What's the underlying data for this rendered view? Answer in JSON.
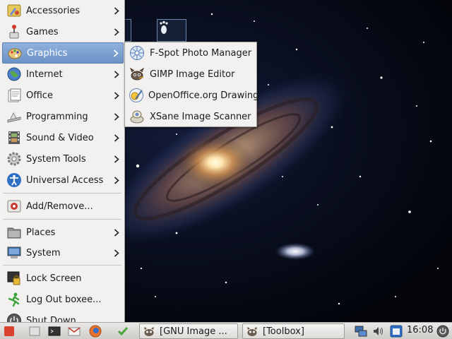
{
  "menu": {
    "items": [
      {
        "label": "Accessories"
      },
      {
        "label": "Games"
      },
      {
        "label": "Graphics"
      },
      {
        "label": "Internet"
      },
      {
        "label": "Office"
      },
      {
        "label": "Programming"
      },
      {
        "label": "Sound & Video"
      },
      {
        "label": "System Tools"
      },
      {
        "label": "Universal Access"
      }
    ],
    "add_remove": "Add/Remove...",
    "places": "Places",
    "system": "System",
    "lock_screen": "Lock Screen",
    "log_out": "Log Out boxee...",
    "shut_down": "Shut Down..."
  },
  "graphics_submenu": {
    "items": [
      {
        "label": "F-Spot Photo Manager"
      },
      {
        "label": "GIMP Image Editor"
      },
      {
        "label": "OpenOffice.org Drawing"
      },
      {
        "label": "XSane Image Scanner"
      }
    ]
  },
  "taskbar": {
    "windows": [
      {
        "label": "[GNU Image ..."
      },
      {
        "label": "[Toolbox]"
      }
    ],
    "clock": "16:08"
  },
  "colors": {
    "menu_bg": "#f2f1f0",
    "highlight": "#7a9fd0",
    "panel_bg": "#dcdad7"
  }
}
